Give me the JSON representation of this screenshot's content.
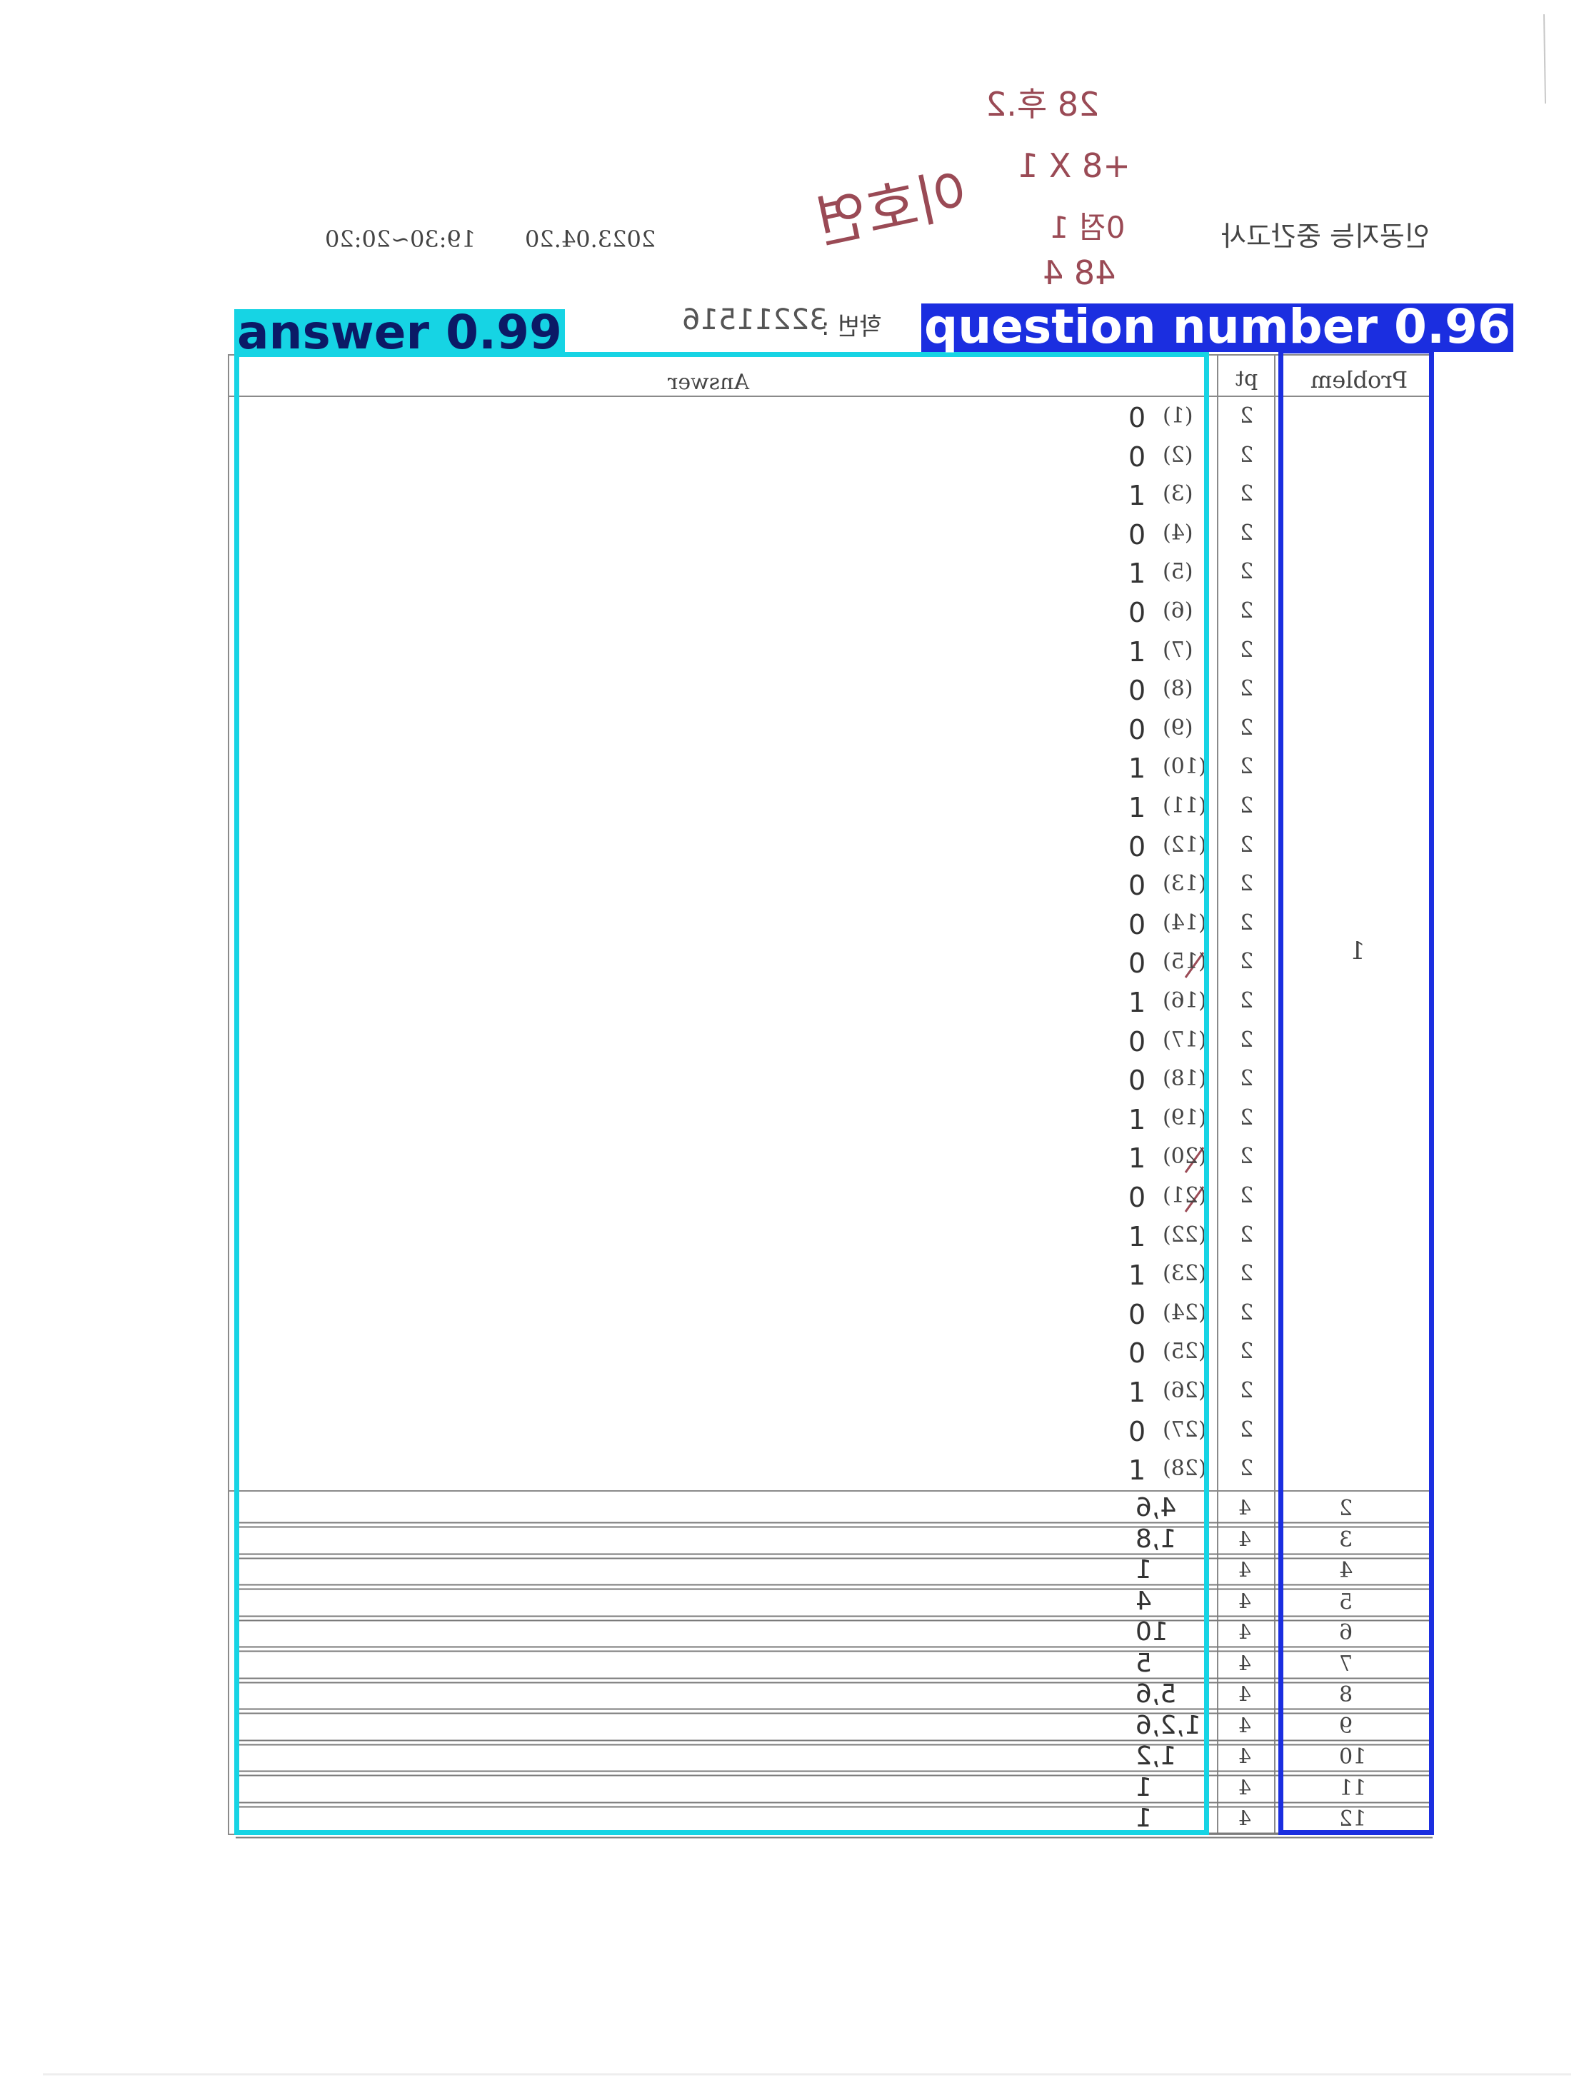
{
  "header": {
    "course_title": "인공지능 중간고사",
    "date": "2023.04.20",
    "time": "19:30~20:20",
    "student_id_label": "학번 :",
    "student_id_value": "32211516"
  },
  "handwritten_notes": {
    "name": "이호연",
    "tallies": [
      "28 후.2",
      "+8 X 1",
      "0점 1",
      "48 4"
    ]
  },
  "columns": {
    "problem": "Problem",
    "pt": "pt",
    "answer": "Answer"
  },
  "problem1": {
    "number": "1",
    "rows": [
      {
        "label": "(1)",
        "pt": "2",
        "ans": "0"
      },
      {
        "label": "(2)",
        "pt": "2",
        "ans": "0"
      },
      {
        "label": "(3)",
        "pt": "2",
        "ans": "1"
      },
      {
        "label": "(4)",
        "pt": "2",
        "ans": "0"
      },
      {
        "label": "(5)",
        "pt": "2",
        "ans": "1"
      },
      {
        "label": "(6)",
        "pt": "2",
        "ans": "0"
      },
      {
        "label": "(7)",
        "pt": "2",
        "ans": "1"
      },
      {
        "label": "(8)",
        "pt": "2",
        "ans": "0"
      },
      {
        "label": "(9)",
        "pt": "2",
        "ans": "0"
      },
      {
        "label": "(10)",
        "pt": "2",
        "ans": "1"
      },
      {
        "label": "(11)",
        "pt": "2",
        "ans": "1"
      },
      {
        "label": "(12)",
        "pt": "2",
        "ans": "0"
      },
      {
        "label": "(13)",
        "pt": "2",
        "ans": "0"
      },
      {
        "label": "(14)",
        "pt": "2",
        "ans": "0"
      },
      {
        "label": "(15)",
        "pt": "2",
        "ans": "0"
      },
      {
        "label": "(16)",
        "pt": "2",
        "ans": "1"
      },
      {
        "label": "(17)",
        "pt": "2",
        "ans": "0"
      },
      {
        "label": "(18)",
        "pt": "2",
        "ans": "0"
      },
      {
        "label": "(19)",
        "pt": "2",
        "ans": "1"
      },
      {
        "label": "(20)",
        "pt": "2",
        "ans": "1"
      },
      {
        "label": "(21)",
        "pt": "2",
        "ans": "0"
      },
      {
        "label": "(22)",
        "pt": "2",
        "ans": "1"
      },
      {
        "label": "(23)",
        "pt": "2",
        "ans": "1"
      },
      {
        "label": "(24)",
        "pt": "2",
        "ans": "0"
      },
      {
        "label": "(25)",
        "pt": "2",
        "ans": "0"
      },
      {
        "label": "(26)",
        "pt": "2",
        "ans": "1"
      },
      {
        "label": "(27)",
        "pt": "2",
        "ans": "0"
      },
      {
        "label": "(28)",
        "pt": "2",
        "ans": "1"
      }
    ]
  },
  "problems": [
    {
      "number": "2",
      "pt": "4",
      "ans": "4,6"
    },
    {
      "number": "3",
      "pt": "4",
      "ans": "1,8"
    },
    {
      "number": "4",
      "pt": "4",
      "ans": "1"
    },
    {
      "number": "5",
      "pt": "4",
      "ans": "4"
    },
    {
      "number": "6",
      "pt": "4",
      "ans": "10"
    },
    {
      "number": "7",
      "pt": "4",
      "ans": "5"
    },
    {
      "number": "8",
      "pt": "4",
      "ans": "5,6"
    },
    {
      "number": "9",
      "pt": "4",
      "ans": "1,2,6"
    },
    {
      "number": "10",
      "pt": "4",
      "ans": "1,2"
    },
    {
      "number": "11",
      "pt": "4",
      "ans": "1"
    },
    {
      "number": "12",
      "pt": "4",
      "ans": "1"
    }
  ],
  "detections": [
    {
      "label": "answer 0.99",
      "color": "#16d4e4",
      "text_color": "#0b1a66"
    },
    {
      "label": "question number 0.96",
      "color": "#1b2ee0",
      "text_color": "#ffffff"
    }
  ]
}
